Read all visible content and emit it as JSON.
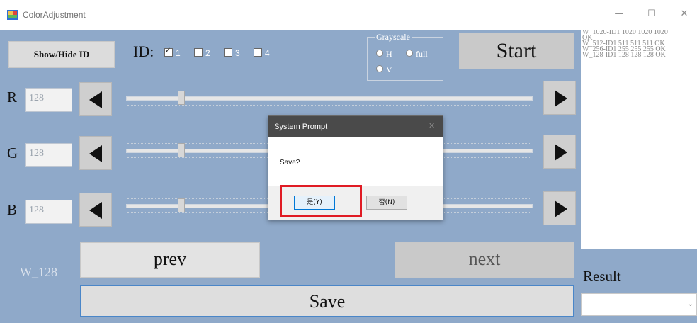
{
  "window": {
    "title": "ColorAdjustment",
    "minimize": "—",
    "maximize": "☐",
    "close": "✕"
  },
  "toolbar": {
    "show_hide_label": "Show/Hide ID",
    "id_label": "ID:",
    "checkboxes": [
      {
        "label": "1",
        "checked": true
      },
      {
        "label": "2",
        "checked": false
      },
      {
        "label": "3",
        "checked": false
      },
      {
        "label": "4",
        "checked": false
      }
    ],
    "grayscale": {
      "legend": "Grayscale",
      "options": [
        "H",
        "full",
        "V"
      ]
    },
    "start_label": "Start"
  },
  "channels": [
    {
      "label": "R",
      "value": "128"
    },
    {
      "label": "G",
      "value": "128"
    },
    {
      "label": "B",
      "value": "128"
    }
  ],
  "slider_fraction": 0.128,
  "nav": {
    "prev_label": "prev",
    "next_label": "next",
    "save_label": "Save",
    "current": "W_128"
  },
  "results": {
    "lines": [
      "W_1020-ID1  1020  1020  1020",
      "OK",
      "W_512-ID1  511  511  511 OK",
      "W_256-ID1  255  255  255 OK",
      "W_128-ID1  128  128  128 OK"
    ],
    "label": "Result",
    "dropdown_icon": "chevron-down-icon"
  },
  "dialog": {
    "title": "System Prompt",
    "close": "✕",
    "message": "Save?",
    "yes_label": "是(Y)",
    "no_label": "否(N)"
  },
  "colors": {
    "background": "#8fa9c9",
    "dialog_title": "#4a4a4a",
    "highlight": "#e01b24"
  }
}
